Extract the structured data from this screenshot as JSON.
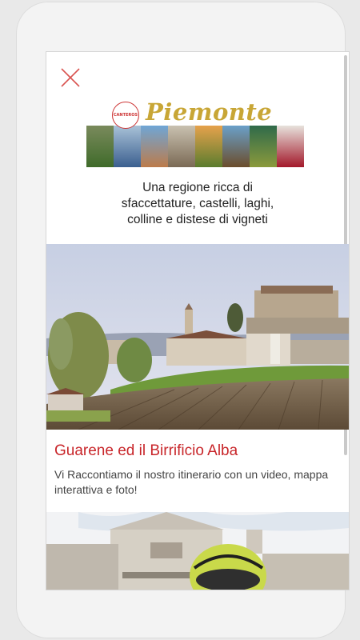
{
  "header": {
    "close_icon": "close-icon",
    "logo_badge_text": "CANTEROS",
    "logo_title": "Piemonte"
  },
  "intro": {
    "line1": "Una regione ricca di",
    "line2": "sfaccettature, castelli, laghi,",
    "line3": "colline e distese di vigneti"
  },
  "article": {
    "title": "Guarene ed il Birrificio Alba",
    "description": "Vi Raccontiamo il nostro itinerario con un video, mappa interattiva e foto!"
  },
  "colors": {
    "accent_red": "#c8262a",
    "logo_gold": "#c8a636"
  }
}
